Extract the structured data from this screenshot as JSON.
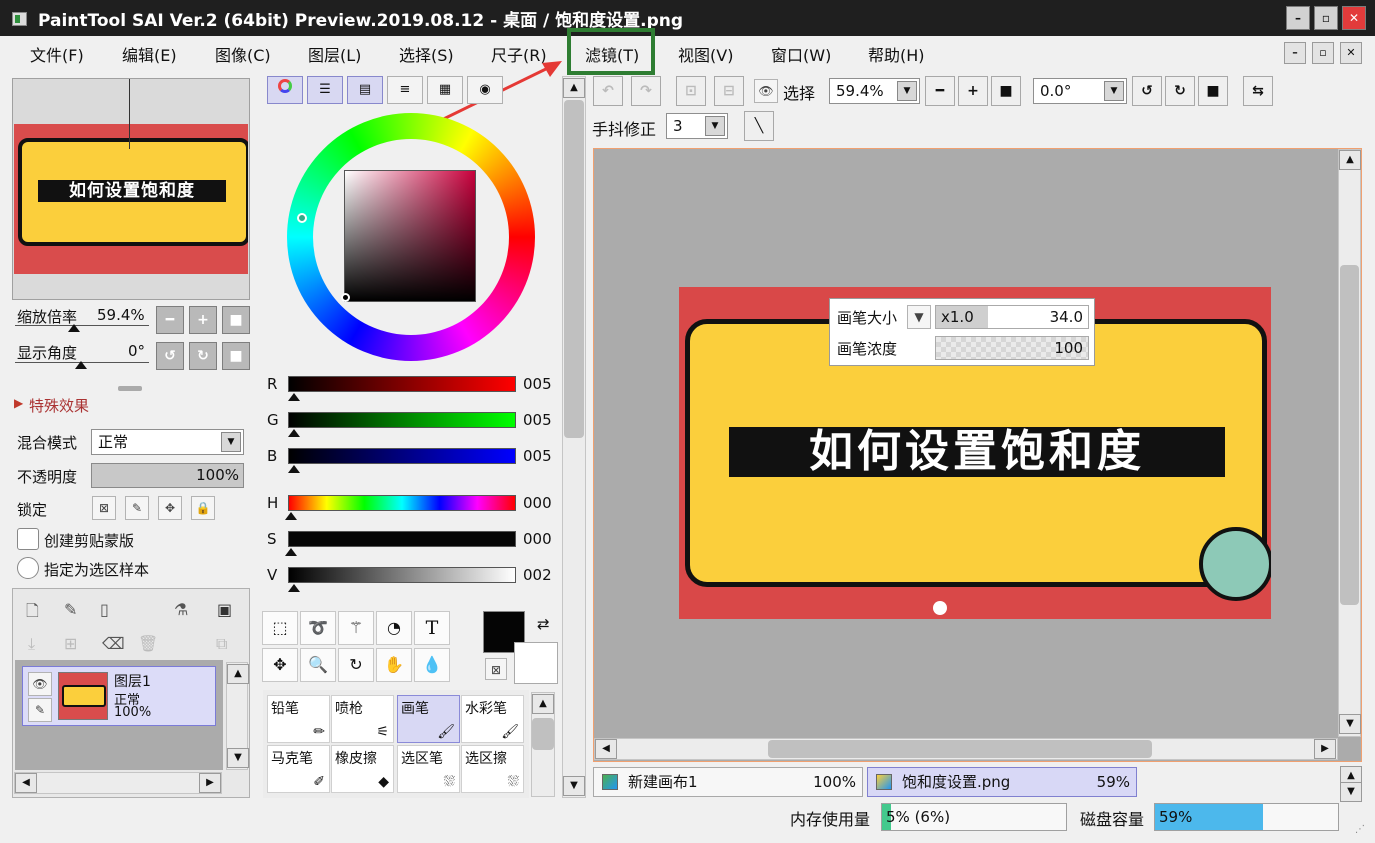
{
  "window": {
    "title": "PaintTool SAI Ver.2 (64bit) Preview.2019.08.12 - 桌面 / 饱和度设置.png",
    "min": "–",
    "max": "▫",
    "close": "✕"
  },
  "menu": {
    "items": [
      "文件(F)",
      "编辑(E)",
      "图像(C)",
      "图层(L)",
      "选择(S)",
      "尺子(R)",
      "滤镜(T)",
      "视图(V)",
      "窗口(W)",
      "帮助(H)"
    ],
    "highlighted": "滤镜(T)",
    "highlight_color": "#2e7d32",
    "arrow_color": "#e53935"
  },
  "navigator": {
    "preview_text": "如何设置饱和度",
    "zoom_label": "缩放倍率",
    "zoom_value": "59.4%",
    "angle_label": "显示角度",
    "angle_value": "0°"
  },
  "layer_panel": {
    "effects_label": "特殊效果",
    "blend_label": "混合模式",
    "blend_value": "正常",
    "opacity_label": "不透明度",
    "opacity_value": "100%",
    "opacity_level": 1.0,
    "lock_label": "锁定",
    "clip_label": "创建剪贴蒙版",
    "sample_label": "指定为选区样本",
    "layer": {
      "name": "图层1",
      "mode": "正常",
      "opacity": "100%"
    }
  },
  "color": {
    "channels": [
      {
        "name": "R",
        "value": "005"
      },
      {
        "name": "G",
        "value": "005"
      },
      {
        "name": "B",
        "value": "005"
      },
      {
        "name": "H",
        "value": "000"
      },
      {
        "name": "S",
        "value": "000"
      },
      {
        "name": "V",
        "value": "002"
      }
    ],
    "foreground": "#050505",
    "background": "#ffffff"
  },
  "tools": {
    "text_tool": "T"
  },
  "brushes": [
    {
      "name": "铅笔",
      "active": false
    },
    {
      "name": "喷枪",
      "active": false
    },
    {
      "name": "画笔",
      "active": true
    },
    {
      "name": "水彩笔",
      "active": false
    },
    {
      "name": "马克笔",
      "active": false
    },
    {
      "name": "橡皮擦",
      "active": false
    },
    {
      "name": "选区笔",
      "active": false
    },
    {
      "name": "选区擦",
      "active": false
    }
  ],
  "toolbar": {
    "select_label": "选择",
    "zoom": "59.4%",
    "angle": "0.0°",
    "stabilizer_label": "手抖修正",
    "stabilizer_value": "3"
  },
  "canvas": {
    "art_title": "如何设置饱和度",
    "brush_size_label": "画笔大小",
    "brush_size_mult": "x1.0",
    "brush_size_value": "34.0",
    "brush_density_label": "画笔浓度",
    "brush_density_value": "100"
  },
  "doc_tabs": [
    {
      "name": "新建画布1",
      "zoom": "100%"
    },
    {
      "name": "饱和度设置.png",
      "zoom": "59%"
    }
  ],
  "status": {
    "mem_label": "内存使用量",
    "mem_value": "5% (6%)",
    "mem_level": 0.05,
    "disk_label": "磁盘容量",
    "disk_value": "59%",
    "disk_level": 0.59
  }
}
